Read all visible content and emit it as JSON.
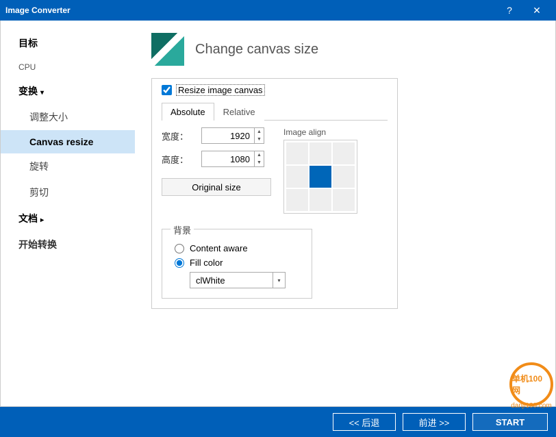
{
  "window": {
    "title": "Image Converter"
  },
  "sidebar": {
    "items": [
      {
        "label": "目标",
        "type": "top"
      },
      {
        "label": "CPU",
        "type": "top-plain"
      },
      {
        "label": "变换",
        "type": "top",
        "expanded": true
      },
      {
        "label": "调整大小",
        "type": "sub"
      },
      {
        "label": "Canvas resize",
        "type": "sub",
        "selected": true
      },
      {
        "label": "旋转",
        "type": "sub"
      },
      {
        "label": "剪切",
        "type": "sub"
      },
      {
        "label": "文档",
        "type": "top",
        "expanded": false
      },
      {
        "label": "开始转换",
        "type": "top-plain"
      }
    ]
  },
  "page": {
    "title": "Change canvas size"
  },
  "resize": {
    "checkbox_label": "Resize image canvas",
    "checked": true,
    "tabs": {
      "absolute": "Absolute",
      "relative": "Relative",
      "active": "absolute"
    },
    "width_label": "宽度：",
    "height_label": "高度：",
    "width": "1920",
    "height": "1080",
    "original_btn": "Original size",
    "align_label": "Image align",
    "align_selected": 4
  },
  "background": {
    "legend": "背景",
    "content_aware": "Content aware",
    "fill_color": "Fill color",
    "selected": "fill",
    "color_value": "clWhite"
  },
  "footer": {
    "back": "<<  后退",
    "forward": "前进  >>",
    "start": "START"
  },
  "watermark": {
    "top": "单机100网",
    "sub": "danji100.com"
  }
}
